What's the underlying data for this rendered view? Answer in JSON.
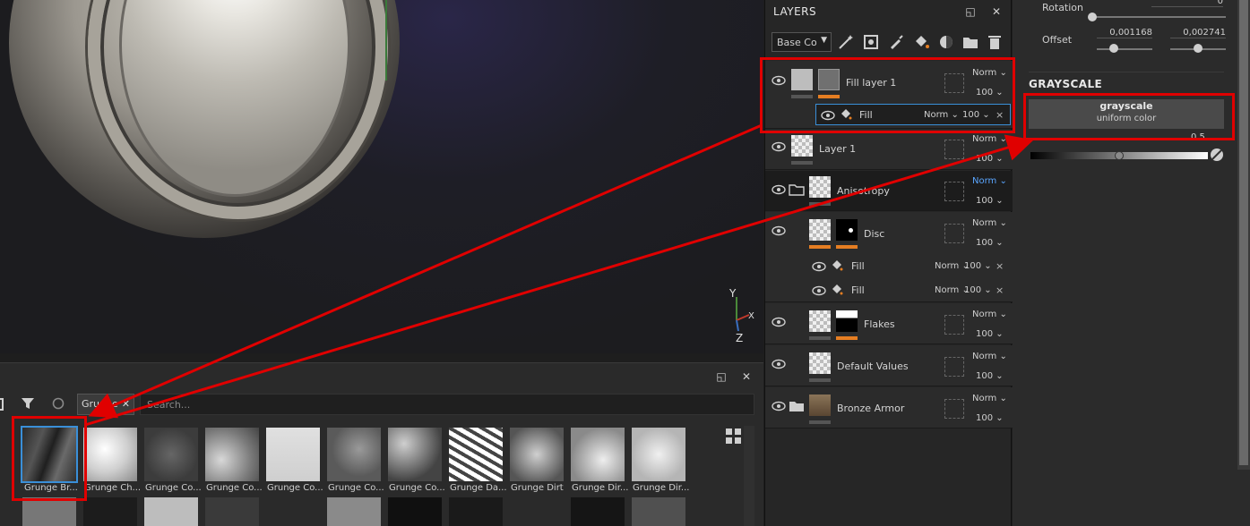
{
  "layers_panel": {
    "title": "LAYERS",
    "channel": "Base Color",
    "layers": [
      {
        "name": "Fill layer 1",
        "blend": "Norm",
        "opacity": "100"
      },
      {
        "name": "Layer 1",
        "blend": "Norm",
        "opacity": "100"
      },
      {
        "name": "Anisotropy",
        "blend": "Norm",
        "opacity": "100"
      },
      {
        "name": "Disc",
        "blend": "Norm",
        "opacity": "100"
      },
      {
        "name": "Flakes",
        "blend": "Norm",
        "opacity": "100"
      },
      {
        "name": "Default Values",
        "blend": "Norm",
        "opacity": "100"
      },
      {
        "name": "Bronze Armor",
        "blend": "Norm",
        "opacity": "100"
      }
    ],
    "effects": [
      {
        "name": "Fill",
        "blend": "Norm",
        "opacity": "100"
      },
      {
        "name": "Fill",
        "blend": "Norm",
        "opacity": "100"
      },
      {
        "name": "Fill",
        "blend": "Norm",
        "opacity": "100"
      }
    ]
  },
  "properties": {
    "rotation_label": "Rotation",
    "rotation_value": "0",
    "offset_label": "Offset",
    "offset_x": "0,001168",
    "offset_y": "0,002741",
    "section_title": "GRAYSCALE",
    "input_name": "grayscale",
    "input_type": "uniform color",
    "value": "0,5",
    "value_fraction": 0.5
  },
  "assets": {
    "filter_tag": "Grunge",
    "search_placeholder": "Search...",
    "items": [
      "Grunge Br...",
      "Grunge Ch...",
      "Grunge Co...",
      "Grunge Co...",
      "Grunge Co...",
      "Grunge Co...",
      "Grunge Co...",
      "Grunge Da...",
      "Grunge Dirt",
      "Grunge Dir...",
      "Grunge Dir..."
    ]
  },
  "viewport": {
    "axis_y": "Y",
    "axis_x": "X",
    "axis_z": "Z"
  }
}
